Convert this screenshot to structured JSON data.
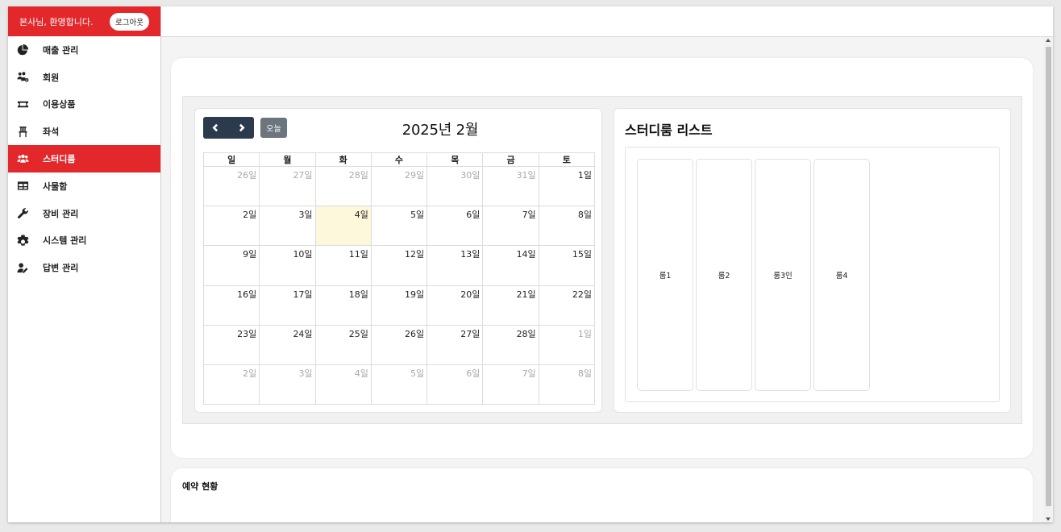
{
  "sidebar": {
    "welcome": "본사님, 환영합니다.",
    "logout_label": "로그아웃",
    "brand_color": "#e3282c",
    "items": [
      {
        "label": "매출 관리",
        "icon": "pie-chart-icon"
      },
      {
        "label": "회원",
        "icon": "users-cog-icon"
      },
      {
        "label": "이용상품",
        "icon": "ticket-icon"
      },
      {
        "label": "좌석",
        "icon": "chair-icon"
      },
      {
        "label": "스터디룸",
        "icon": "users-icon",
        "active": true
      },
      {
        "label": "사물함",
        "icon": "table-icon"
      },
      {
        "label": "장비 관리",
        "icon": "wrench-icon"
      },
      {
        "label": "시스템 관리",
        "icon": "gear-icon"
      },
      {
        "label": "답변 관리",
        "icon": "user-edit-icon"
      }
    ]
  },
  "calendar": {
    "title": "2025년 2월",
    "today_label": "오늘",
    "weekdays": [
      "일",
      "월",
      "화",
      "수",
      "목",
      "금",
      "토"
    ],
    "weeks": [
      [
        {
          "d": "26일",
          "o": true
        },
        {
          "d": "27일",
          "o": true
        },
        {
          "d": "28일",
          "o": true
        },
        {
          "d": "29일",
          "o": true
        },
        {
          "d": "30일",
          "o": true
        },
        {
          "d": "31일",
          "o": true
        },
        {
          "d": "1일"
        }
      ],
      [
        {
          "d": "2일"
        },
        {
          "d": "3일"
        },
        {
          "d": "4일",
          "today": true
        },
        {
          "d": "5일"
        },
        {
          "d": "6일"
        },
        {
          "d": "7일"
        },
        {
          "d": "8일"
        }
      ],
      [
        {
          "d": "9일"
        },
        {
          "d": "10일"
        },
        {
          "d": "11일"
        },
        {
          "d": "12일"
        },
        {
          "d": "13일"
        },
        {
          "d": "14일"
        },
        {
          "d": "15일"
        }
      ],
      [
        {
          "d": "16일"
        },
        {
          "d": "17일"
        },
        {
          "d": "18일"
        },
        {
          "d": "19일"
        },
        {
          "d": "20일"
        },
        {
          "d": "21일"
        },
        {
          "d": "22일"
        }
      ],
      [
        {
          "d": "23일"
        },
        {
          "d": "24일"
        },
        {
          "d": "25일"
        },
        {
          "d": "26일"
        },
        {
          "d": "27일"
        },
        {
          "d": "28일"
        },
        {
          "d": "1일",
          "o": true
        }
      ],
      [
        {
          "d": "2일",
          "o": true
        },
        {
          "d": "3일",
          "o": true
        },
        {
          "d": "4일",
          "o": true
        },
        {
          "d": "5일",
          "o": true
        },
        {
          "d": "6일",
          "o": true
        },
        {
          "d": "7일",
          "o": true
        },
        {
          "d": "8일",
          "o": true
        }
      ]
    ]
  },
  "rooms": {
    "title": "스터디룸 리스트",
    "items": [
      "룸1",
      "룸2",
      "룸3인",
      "룸4"
    ]
  },
  "reservation": {
    "title": "예약 현황"
  }
}
